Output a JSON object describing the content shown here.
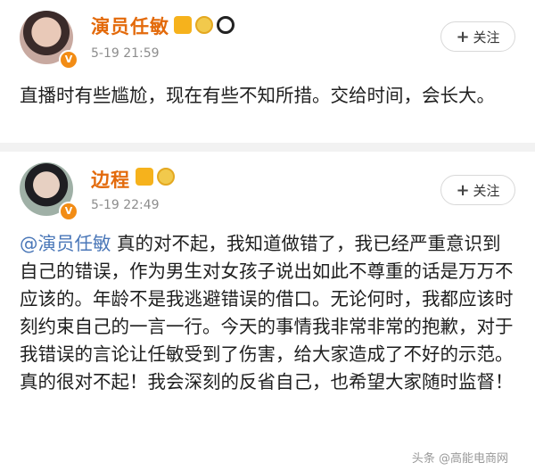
{
  "posts": [
    {
      "author": "演员任敏",
      "time": "5-19 21:59",
      "follow_label": "关注",
      "body": "直播时有些尴尬，现在有些不知所措。交给时间，会长大。",
      "badges": [
        "crown-icon",
        "medal-icon",
        "panda-icon"
      ]
    },
    {
      "author": "边程",
      "time": "5-19 22:49",
      "follow_label": "关注",
      "mention": "@演员任敏",
      "body": " 真的对不起，我知道做错了，我已经严重意识到自己的错误，作为男生对女孩子说出如此不尊重的话是万万不应该的。年龄不是我逃避错误的借口。无论何时，我都应该时刻约束自己的一言一行。今天的事情我非常非常的抱歉，对于我错误的言论让任敏受到了伤害，给大家造成了不好的示范。真的很对不起！我会深刻的反省自己，也希望大家随时监督！",
      "badges": [
        "crown-icon",
        "medal-icon"
      ]
    }
  ],
  "vbadge": "V",
  "plus_symbol": "+",
  "watermark": "头条 @高能电商网",
  "colors": {
    "name": "#e36a0b",
    "mention": "#4a77b8",
    "meta": "#8d8d8d"
  }
}
